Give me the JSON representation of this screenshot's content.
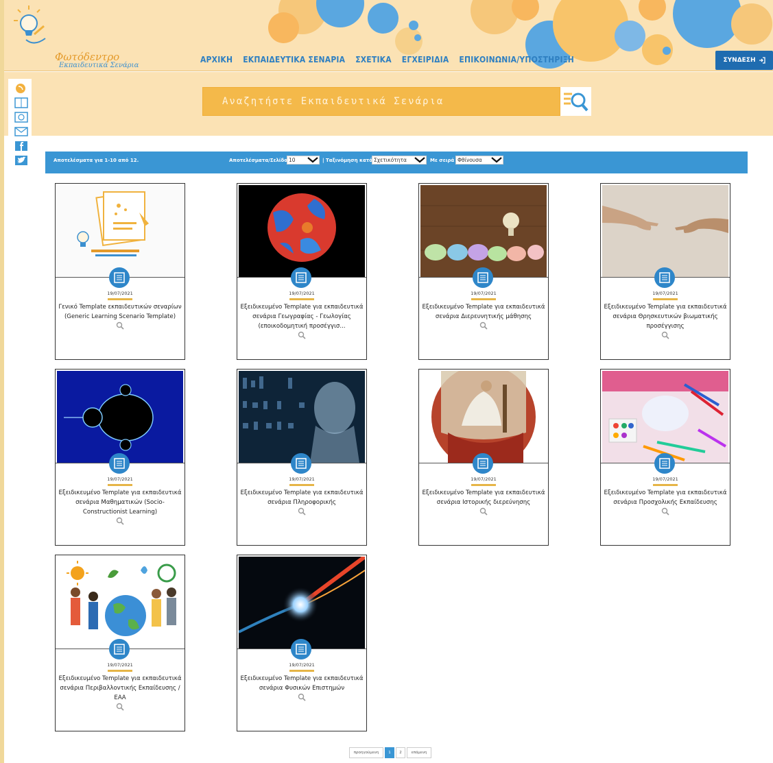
{
  "header": {
    "logo_title": "Φωτόδεντρο",
    "logo_subtitle": "Εκπαιδευτικά Σενάρια",
    "nav": [
      {
        "label": "ΑΡΧΙΚΗ"
      },
      {
        "label": "ΕΚΠΑΙΔΕΥΤΙΚΑ ΣΕΝΑΡΙΑ"
      },
      {
        "label": "ΣΧΕΤΙΚΑ"
      },
      {
        "label": "ΕΓΧΕΙΡΙΔΙΑ"
      },
      {
        "label": "ΕΠΙΚΟΙΝΩΝΙΑ/ΥΠΟΣΤΗΡΙΞΗ"
      }
    ],
    "login_label": "ΣΥΝΔΕΣΗ"
  },
  "search": {
    "placeholder": "Αναζητήστε Εκπαιδευτικά Σενάρια"
  },
  "results_bar": {
    "count_text": "Αποτελέσματα για 1-10 από 12.",
    "per_page_label": "Αποτελέσματα/Σελίδα",
    "per_page_value": "10",
    "sort_label": "| Ταξινόμηση κατά",
    "sort_value": "Σχετικότητα",
    "order_label": "Με σειρά",
    "order_value": "Φθίνουσα"
  },
  "cards": [
    {
      "date": "19/07/2021",
      "title": "Γενικό Template εκπαιδευτικών σεναρίων (Generic Learning Scenario Template)",
      "image": "logo-thumbnail"
    },
    {
      "date": "19/07/2021",
      "title": "Εξειδικευμένο Template για εκπαιδευτικά σενάρια Γεωγραφίας - Γεωλογίας (εποικοδομητική προσέγγισ...",
      "image": "globe-thumbnail"
    },
    {
      "date": "19/07/2021",
      "title": "Εξειδικευμένο Template για εκπαιδευτικά σενάρια Διερευνητικής μάθησης",
      "image": "clay-bulb-thumbnail"
    },
    {
      "date": "19/07/2021",
      "title": "Εξειδικευμένο Template για εκπαιδευτικά σενάρια Θρησκευτικών βιωματικής προσέγγισης",
      "image": "hands-thumbnail"
    },
    {
      "date": "19/07/2021",
      "title": "Εξειδικευμένο Template για εκπαιδευτικά σενάρια Μαθηματικών (Socio-Constructionist Learning)",
      "image": "fractal-thumbnail"
    },
    {
      "date": "19/07/2021",
      "title": "Εξειδικευμένο Template για εκπαιδευτικά σενάρια Πληροφορικής",
      "image": "digital-head-thumbnail"
    },
    {
      "date": "19/07/2021",
      "title": "Εξειδικευμένο Template για εκπαιδευτικά σενάρια Ιστορικής διερεύνησης",
      "image": "ancient-painting-thumbnail"
    },
    {
      "date": "19/07/2021",
      "title": "Εξειδικευμένο Template για εκπαιδευτικά σενάρια Προσχολικής Εκπαίδευσης",
      "image": "art-supplies-thumbnail"
    },
    {
      "date": "19/07/2021",
      "title": "Εξειδικευμένο Template για εκπαιδευτικά σενάρια Περιβαλλοντικής Εκπαίδευσης / ΕΑΑ",
      "image": "environment-thumbnail"
    },
    {
      "date": "19/07/2021",
      "title": "Εξειδικευμένο Template για εκπαιδευτικά σενάρια Φυσικών Επιστημών",
      "image": "light-streak-thumbnail"
    }
  ],
  "pagination": {
    "prev_label": "προηγούμενη",
    "pages": [
      "1",
      "2"
    ],
    "next_label": "επόμενη"
  },
  "colors": {
    "header_bg": "#fbe2b4",
    "accent_blue": "#3a96d4",
    "nav_blue": "#2e7fc1",
    "search_orange": "#f4b94a",
    "underline_gold": "#e6b547"
  }
}
